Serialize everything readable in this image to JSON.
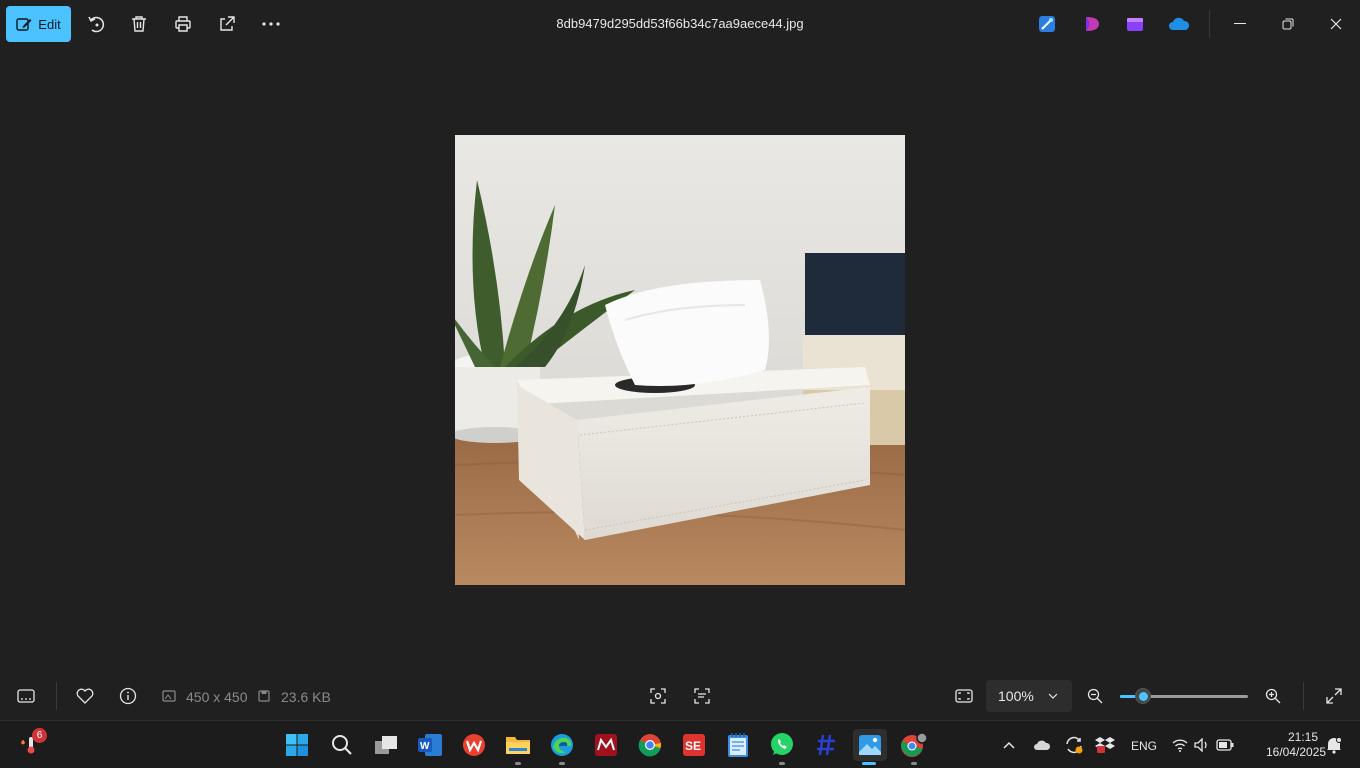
{
  "toolbar": {
    "edit_label": "Edit",
    "title": "8db9479d295dd53f66b34c7aa9aece44.jpg",
    "accent": "#4cc2ff"
  },
  "toolbar_icons": [
    "edit-icon",
    "rotate-icon",
    "delete-icon",
    "print-icon",
    "share-icon",
    "more-icon"
  ],
  "app_shortcuts": [
    "designer-icon",
    "clipchamp-icon",
    "clipchamp-video-icon",
    "onedrive-icon"
  ],
  "image": {
    "alt": "tissue-box-photo"
  },
  "bottom": {
    "dimensions": "450 x 450",
    "filesize": "23.6 KB",
    "zoom_value": "100%",
    "zoom_level_fraction": 0.18
  },
  "taskbar": {
    "apps": [
      "start-icon",
      "search-icon",
      "task-view-icon",
      "word-icon",
      "wps-icon",
      "file-explorer-icon",
      "edge-icon",
      "mendeley-icon",
      "chrome-icon",
      "slides-icon",
      "notepad-icon",
      "whatsapp-icon",
      "hash-app-icon",
      "photos-icon",
      "chrome-profile-icon"
    ],
    "weather_badge": "6",
    "language": "ENG",
    "time": "21:15",
    "date": "16/04/2025"
  }
}
